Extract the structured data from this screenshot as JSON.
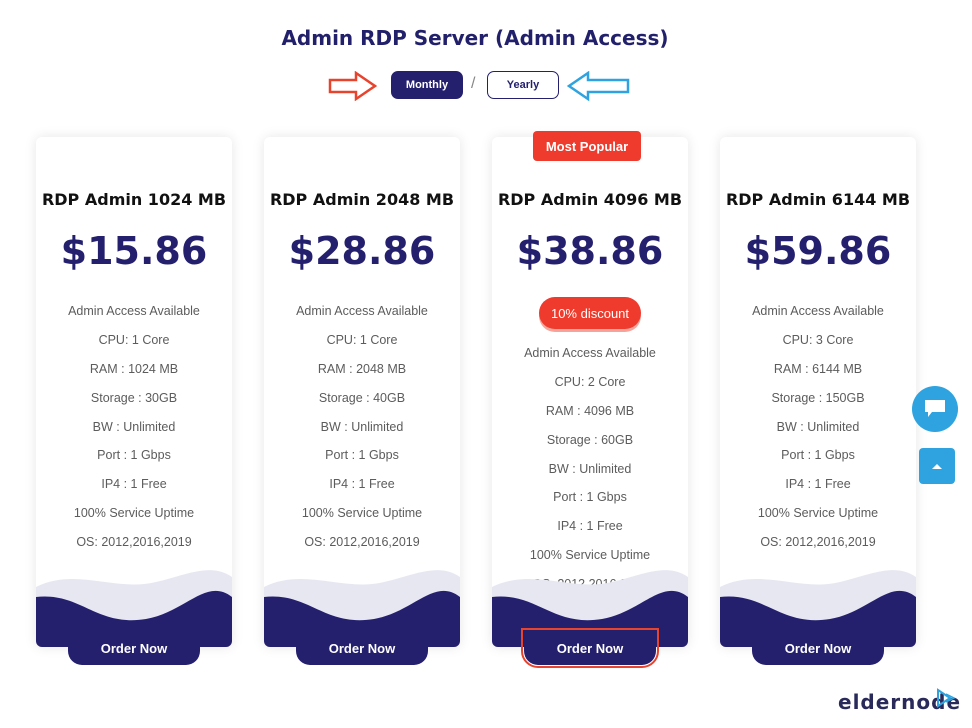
{
  "page": {
    "title": "Admin RDP Server (Admin Access)"
  },
  "billing_toggle": {
    "monthly_label": "Monthly",
    "separator": "/",
    "yearly_label": "Yearly",
    "selected": "Monthly"
  },
  "colors": {
    "brand_navy": "#24206e",
    "accent_red": "#ef3b2d",
    "accent_blue": "#2ea3df"
  },
  "plans": [
    {
      "name": "RDP Admin 1024 MB",
      "price": "$15.86",
      "features": [
        "Admin Access Available",
        "CPU: 1 Core",
        "RAM : 1024 MB",
        "Storage : 30GB",
        "BW : Unlimited",
        "Port : 1 Gbps",
        "IP4 : 1 Free",
        "100% Service Uptime",
        "OS: 2012,2016,2019"
      ],
      "order_label": "Order Now"
    },
    {
      "name": "RDP Admin 2048 MB",
      "price": "$28.86",
      "features": [
        "Admin Access Available",
        "CPU: 1 Core",
        "RAM : 2048 MB",
        "Storage : 40GB",
        "BW : Unlimited",
        "Port : 1 Gbps",
        "IP4 : 1 Free",
        "100% Service Uptime",
        "OS: 2012,2016,2019"
      ],
      "order_label": "Order Now"
    },
    {
      "name": "RDP Admin 4096 MB",
      "price": "$38.86",
      "badge": "Most Popular",
      "discount": "10% discount",
      "features": [
        "Admin Access Available",
        "CPU: 2 Core",
        "RAM : 4096 MB",
        "Storage : 60GB",
        "BW : Unlimited",
        "Port : 1 Gbps",
        "IP4 : 1 Free",
        "100% Service Uptime",
        "OS: 2012,2016,2019"
      ],
      "order_label": "Order Now"
    },
    {
      "name": "RDP Admin 6144 MB",
      "price": "$59.86",
      "features": [
        "Admin Access Available",
        "CPU: 3 Core",
        "RAM : 6144 MB",
        "Storage : 150GB",
        "BW : Unlimited",
        "Port : 1 Gbps",
        "IP4 : 1 Free",
        "100% Service Uptime",
        "OS: 2012,2016,2019"
      ],
      "order_label": "Order Now"
    }
  ],
  "floating": {
    "chat_icon": "chat-bubble-icon",
    "scroll_top_icon": "chevron-up-icon"
  },
  "logo": {
    "text": "eldernode"
  }
}
